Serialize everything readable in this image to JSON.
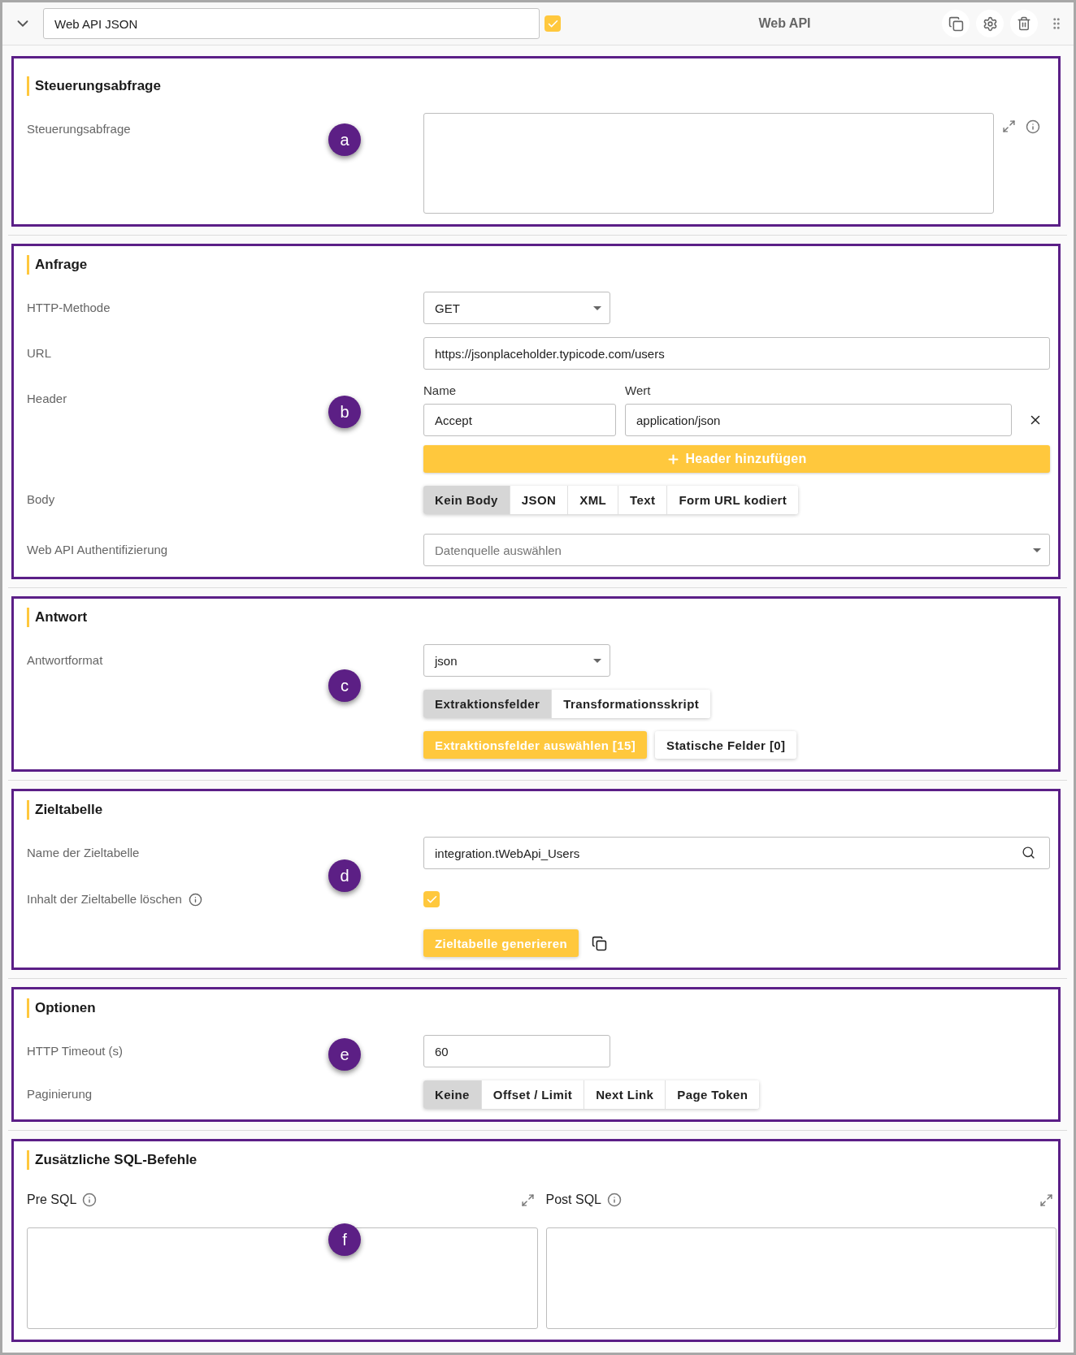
{
  "header": {
    "title_value": "Web API JSON",
    "enabled": true,
    "type_label": "Web API"
  },
  "sections": [
    {
      "title": "Steuerungsabfrage",
      "marker": "a",
      "rows": [
        {
          "kind": "textarea",
          "label": "Steuerungsabfrage",
          "info": true
        }
      ]
    },
    {
      "title": "Anfrage",
      "marker": "b",
      "rows": [
        {
          "kind": "select",
          "label": "HTTP-Methode",
          "value": "GET"
        },
        {
          "kind": "text",
          "label": "URL",
          "value": "https://jsonplaceholder.typicode.com/users"
        },
        {
          "kind": "headers",
          "label": "Header",
          "name_label": "Name",
          "value_label": "Wert",
          "entries": [
            {
              "name": "Accept",
              "value": "application/json"
            }
          ],
          "add_button": "Header hinzufügen"
        },
        {
          "kind": "toggle",
          "label": "Body",
          "options": [
            {
              "label": "Kein Body",
              "selected": true
            },
            {
              "label": "JSON",
              "selected": false
            },
            {
              "label": "XML",
              "selected": false
            },
            {
              "label": "Text",
              "selected": false
            },
            {
              "label": "Form URL kodiert",
              "selected": false
            }
          ]
        },
        {
          "kind": "select",
          "label": "Web API Authentifizierung",
          "placeholder": "Datenquelle auswählen"
        }
      ]
    },
    {
      "title": "Antwort",
      "marker": "c",
      "rows": [
        {
          "kind": "select",
          "label": "Antwortformat",
          "value": "json"
        },
        {
          "kind": "toggle",
          "options": [
            {
              "label": "Extraktionsfelder",
              "selected": true
            },
            {
              "label": "Transformationsskript",
              "selected": false
            }
          ]
        },
        {
          "kind": "buttons",
          "buttons": [
            {
              "label": "Extraktionsfelder auswählen [15]",
              "primary": true
            },
            {
              "label": "Statische Felder [0]",
              "primary": false
            }
          ]
        }
      ]
    },
    {
      "title": "Zieltabelle",
      "marker": "d",
      "rows": [
        {
          "kind": "search",
          "label": "Name der Zieltabelle",
          "value": "integration.tWebApi_Users"
        },
        {
          "kind": "checkbox",
          "label": "Inhalt der Zieltabelle löschen",
          "info": true,
          "checked": true
        },
        {
          "kind": "buttons",
          "buttons": [
            {
              "label": "Zieltabelle generieren",
              "primary": true
            }
          ],
          "copy": true
        }
      ]
    },
    {
      "title": "Optionen",
      "marker": "e",
      "rows": [
        {
          "kind": "number",
          "label": "HTTP Timeout (s)",
          "value": "60"
        },
        {
          "kind": "toggle",
          "label": "Paginierung",
          "options": [
            {
              "label": "Keine",
              "selected": true
            },
            {
              "label": "Offset / Limit",
              "selected": false
            },
            {
              "label": "Next Link",
              "selected": false
            },
            {
              "label": "Page Token",
              "selected": false
            }
          ]
        }
      ]
    },
    {
      "title": "Zusätzliche SQL-Befehle",
      "marker": "f",
      "rows": [
        {
          "kind": "sql",
          "editors": [
            {
              "label": "Pre SQL",
              "info": true
            },
            {
              "label": "Post SQL",
              "info": true
            }
          ]
        }
      ]
    }
  ]
}
